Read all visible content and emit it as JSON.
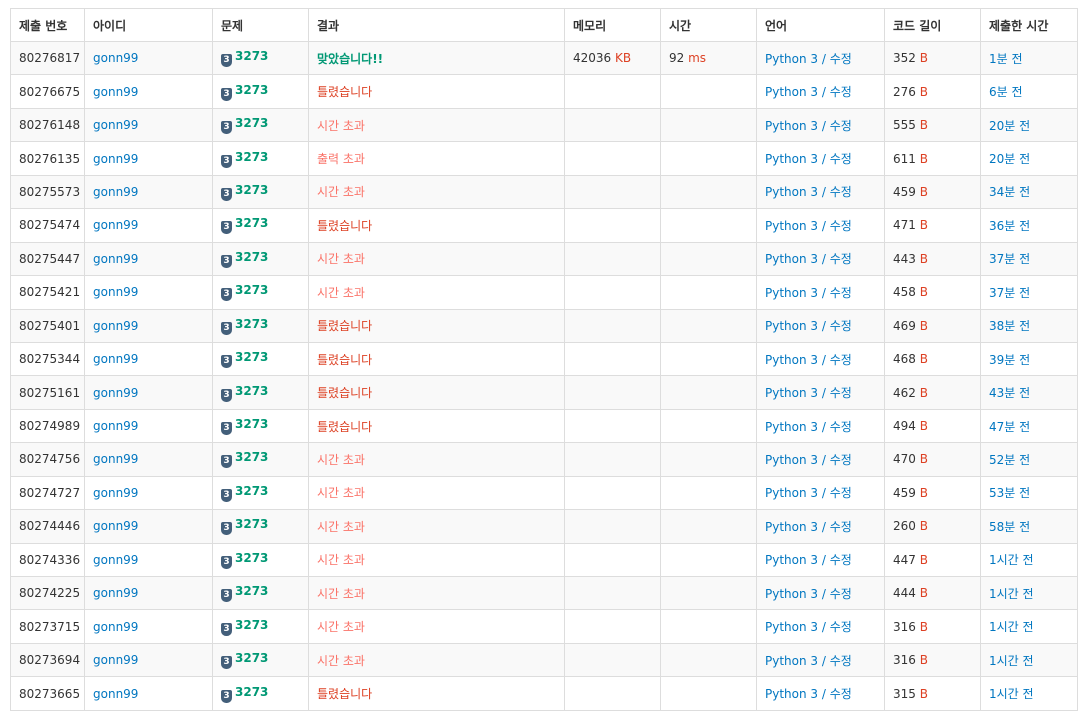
{
  "headers": [
    "제출 번호",
    "아이디",
    "문제",
    "결과",
    "메모리",
    "시간",
    "언어",
    "코드 길이",
    "제출한 시간"
  ],
  "units": {
    "memory": "KB",
    "time": "ms",
    "code": "B"
  },
  "tier_icon_label": "3",
  "language_separator": " / ",
  "rows": [
    {
      "id": "80276817",
      "user": "gonn99",
      "problem": "3273",
      "result": "맞았습니다!!",
      "result_type": "ac",
      "memory": "42036",
      "time": "92",
      "lang": "Python 3",
      "edit": "수정",
      "code": "352",
      "submitted": "1분 전"
    },
    {
      "id": "80276675",
      "user": "gonn99",
      "problem": "3273",
      "result": "틀렸습니다",
      "result_type": "wa",
      "memory": "",
      "time": "",
      "lang": "Python 3",
      "edit": "수정",
      "code": "276",
      "submitted": "6분 전"
    },
    {
      "id": "80276148",
      "user": "gonn99",
      "problem": "3273",
      "result": "시간 초과",
      "result_type": "tle",
      "memory": "",
      "time": "",
      "lang": "Python 3",
      "edit": "수정",
      "code": "555",
      "submitted": "20분 전"
    },
    {
      "id": "80276135",
      "user": "gonn99",
      "problem": "3273",
      "result": "출력 초과",
      "result_type": "ole",
      "memory": "",
      "time": "",
      "lang": "Python 3",
      "edit": "수정",
      "code": "611",
      "submitted": "20분 전"
    },
    {
      "id": "80275573",
      "user": "gonn99",
      "problem": "3273",
      "result": "시간 초과",
      "result_type": "tle",
      "memory": "",
      "time": "",
      "lang": "Python 3",
      "edit": "수정",
      "code": "459",
      "submitted": "34분 전"
    },
    {
      "id": "80275474",
      "user": "gonn99",
      "problem": "3273",
      "result": "틀렸습니다",
      "result_type": "wa",
      "memory": "",
      "time": "",
      "lang": "Python 3",
      "edit": "수정",
      "code": "471",
      "submitted": "36분 전"
    },
    {
      "id": "80275447",
      "user": "gonn99",
      "problem": "3273",
      "result": "시간 초과",
      "result_type": "tle",
      "memory": "",
      "time": "",
      "lang": "Python 3",
      "edit": "수정",
      "code": "443",
      "submitted": "37분 전"
    },
    {
      "id": "80275421",
      "user": "gonn99",
      "problem": "3273",
      "result": "시간 초과",
      "result_type": "tle",
      "memory": "",
      "time": "",
      "lang": "Python 3",
      "edit": "수정",
      "code": "458",
      "submitted": "37분 전"
    },
    {
      "id": "80275401",
      "user": "gonn99",
      "problem": "3273",
      "result": "틀렸습니다",
      "result_type": "wa",
      "memory": "",
      "time": "",
      "lang": "Python 3",
      "edit": "수정",
      "code": "469",
      "submitted": "38분 전"
    },
    {
      "id": "80275344",
      "user": "gonn99",
      "problem": "3273",
      "result": "틀렸습니다",
      "result_type": "wa",
      "memory": "",
      "time": "",
      "lang": "Python 3",
      "edit": "수정",
      "code": "468",
      "submitted": "39분 전"
    },
    {
      "id": "80275161",
      "user": "gonn99",
      "problem": "3273",
      "result": "틀렸습니다",
      "result_type": "wa",
      "memory": "",
      "time": "",
      "lang": "Python 3",
      "edit": "수정",
      "code": "462",
      "submitted": "43분 전"
    },
    {
      "id": "80274989",
      "user": "gonn99",
      "problem": "3273",
      "result": "틀렸습니다",
      "result_type": "wa",
      "memory": "",
      "time": "",
      "lang": "Python 3",
      "edit": "수정",
      "code": "494",
      "submitted": "47분 전"
    },
    {
      "id": "80274756",
      "user": "gonn99",
      "problem": "3273",
      "result": "시간 초과",
      "result_type": "tle",
      "memory": "",
      "time": "",
      "lang": "Python 3",
      "edit": "수정",
      "code": "470",
      "submitted": "52분 전"
    },
    {
      "id": "80274727",
      "user": "gonn99",
      "problem": "3273",
      "result": "시간 초과",
      "result_type": "tle",
      "memory": "",
      "time": "",
      "lang": "Python 3",
      "edit": "수정",
      "code": "459",
      "submitted": "53분 전"
    },
    {
      "id": "80274446",
      "user": "gonn99",
      "problem": "3273",
      "result": "시간 초과",
      "result_type": "tle",
      "memory": "",
      "time": "",
      "lang": "Python 3",
      "edit": "수정",
      "code": "260",
      "submitted": "58분 전"
    },
    {
      "id": "80274336",
      "user": "gonn99",
      "problem": "3273",
      "result": "시간 초과",
      "result_type": "tle",
      "memory": "",
      "time": "",
      "lang": "Python 3",
      "edit": "수정",
      "code": "447",
      "submitted": "1시간 전"
    },
    {
      "id": "80274225",
      "user": "gonn99",
      "problem": "3273",
      "result": "시간 초과",
      "result_type": "tle",
      "memory": "",
      "time": "",
      "lang": "Python 3",
      "edit": "수정",
      "code": "444",
      "submitted": "1시간 전"
    },
    {
      "id": "80273715",
      "user": "gonn99",
      "problem": "3273",
      "result": "시간 초과",
      "result_type": "tle",
      "memory": "",
      "time": "",
      "lang": "Python 3",
      "edit": "수정",
      "code": "316",
      "submitted": "1시간 전"
    },
    {
      "id": "80273694",
      "user": "gonn99",
      "problem": "3273",
      "result": "시간 초과",
      "result_type": "tle",
      "memory": "",
      "time": "",
      "lang": "Python 3",
      "edit": "수정",
      "code": "316",
      "submitted": "1시간 전"
    },
    {
      "id": "80273665",
      "user": "gonn99",
      "problem": "3273",
      "result": "틀렸습니다",
      "result_type": "wa",
      "memory": "",
      "time": "",
      "lang": "Python 3",
      "edit": "수정",
      "code": "315",
      "submitted": "1시간 전"
    }
  ],
  "colors": {
    "link": "#0076c0",
    "accepted": "#009874",
    "wrong": "#dd4124",
    "timeout": "#fa7268",
    "tier_badge": "#435f7a",
    "border": "#dddddd",
    "stripe": "#f9f9f9"
  }
}
